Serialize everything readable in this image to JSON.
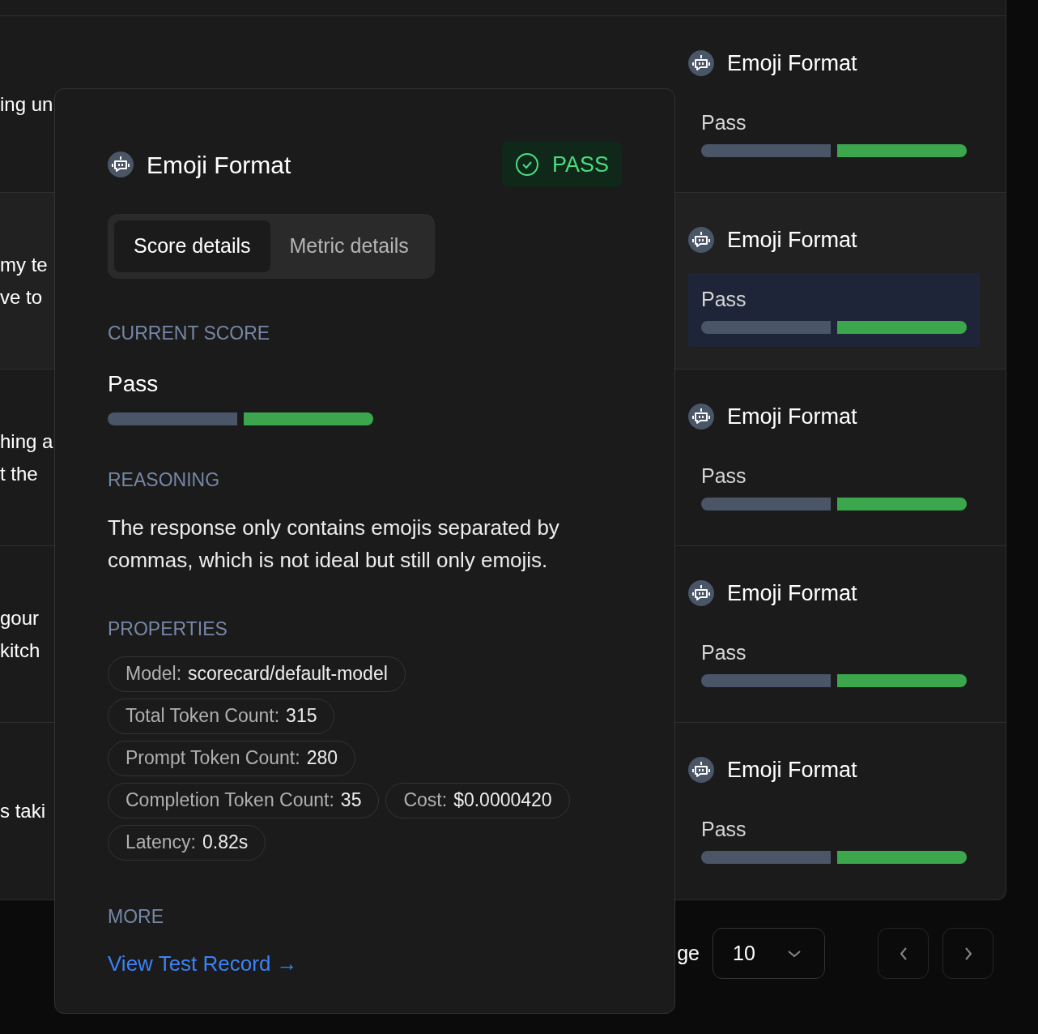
{
  "table": {
    "rows": [
      {
        "input_lines": [
          "ing un"
        ],
        "metric": "Emoji Format",
        "score": "Pass",
        "passed": true,
        "highlighted": false,
        "score_selected": false
      },
      {
        "input_lines": [
          "my te",
          "ve to"
        ],
        "metric": "Emoji Format",
        "score": "Pass",
        "passed": true,
        "highlighted": true,
        "score_selected": true
      },
      {
        "input_lines": [
          "hing a",
          "t the"
        ],
        "metric": "Emoji Format",
        "score": "Pass",
        "passed": true,
        "highlighted": false,
        "score_selected": false
      },
      {
        "input_lines": [
          "gour",
          "kitch"
        ],
        "metric": "Emoji Format",
        "score": "Pass",
        "passed": true,
        "highlighted": false,
        "score_selected": false
      },
      {
        "input_lines": [
          "s taki"
        ],
        "metric": "Emoji Format",
        "score": "Pass",
        "passed": true,
        "highlighted": false,
        "score_selected": false
      }
    ]
  },
  "pagination": {
    "label": "ge",
    "page_size": "10"
  },
  "popover": {
    "title": "Emoji Format",
    "status": {
      "label": "PASS",
      "passed": true
    },
    "tabs": [
      {
        "label": "Score details",
        "selected": true
      },
      {
        "label": "Metric details",
        "selected": false
      }
    ],
    "current_score": {
      "heading": "CURRENT SCORE",
      "value": "Pass",
      "passed": true
    },
    "reasoning": {
      "heading": "REASONING",
      "text": "The response only contains emojis separated by commas, which is not ideal but still only emojis."
    },
    "properties": {
      "heading": "PROPERTIES",
      "items": [
        {
          "label": "Model:",
          "value": "scorecard/default-model"
        },
        {
          "label": "Total Token Count:",
          "value": "315"
        },
        {
          "label": "Prompt Token Count:",
          "value": "280"
        },
        {
          "label": "Completion Token Count:",
          "value": "35"
        },
        {
          "label": "Cost:",
          "value": "$0.0000420"
        },
        {
          "label": "Latency:",
          "value": "0.82s"
        }
      ]
    },
    "more": {
      "heading": "MORE",
      "link": "View Test Record →"
    }
  }
}
